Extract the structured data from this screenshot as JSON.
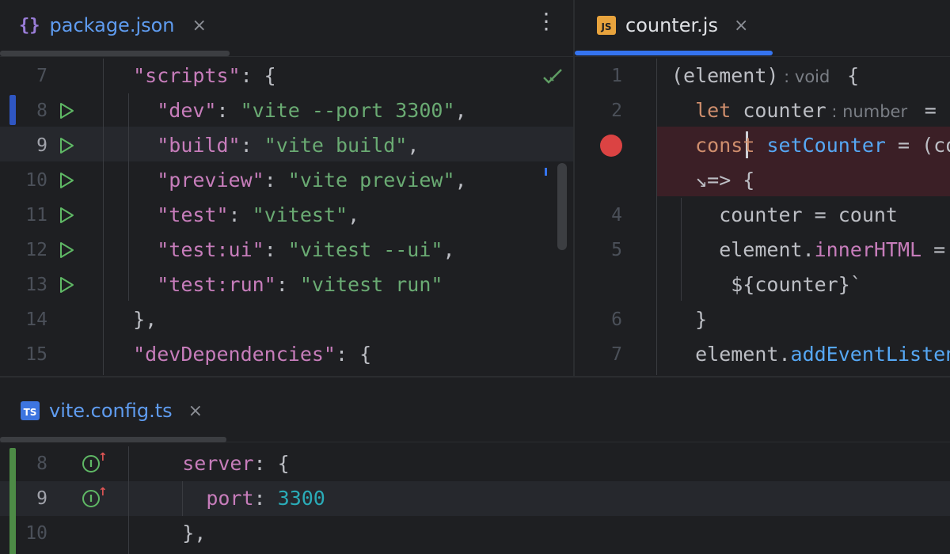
{
  "left_pane": {
    "tab": {
      "icon": "{}",
      "label": "package.json",
      "close": "×"
    },
    "menu_icon": "⋮",
    "lines": [
      {
        "num": "7",
        "tokens": [
          [
            "d",
            "  "
          ],
          [
            "p",
            "\"scripts\""
          ],
          [
            "d",
            ": {"
          ]
        ]
      },
      {
        "num": "8",
        "tokens": [
          [
            "d",
            "    "
          ],
          [
            "p",
            "\"dev\""
          ],
          [
            "d",
            ": "
          ],
          [
            "s",
            "\"vite --port 3300\""
          ],
          [
            "d",
            ","
          ]
        ]
      },
      {
        "num": "9",
        "tokens": [
          [
            "d",
            "    "
          ],
          [
            "p",
            "\"build\""
          ],
          [
            "d",
            ": "
          ],
          [
            "s",
            "\"vite build\""
          ],
          [
            "d",
            ","
          ]
        ]
      },
      {
        "num": "10",
        "tokens": [
          [
            "d",
            "    "
          ],
          [
            "p",
            "\"preview\""
          ],
          [
            "d",
            ": "
          ],
          [
            "s",
            "\"vite preview\""
          ],
          [
            "d",
            ","
          ]
        ]
      },
      {
        "num": "11",
        "tokens": [
          [
            "d",
            "    "
          ],
          [
            "p",
            "\"test\""
          ],
          [
            "d",
            ": "
          ],
          [
            "s",
            "\"vitest\""
          ],
          [
            "d",
            ","
          ]
        ]
      },
      {
        "num": "12",
        "tokens": [
          [
            "d",
            "    "
          ],
          [
            "p",
            "\"test:ui\""
          ],
          [
            "d",
            ": "
          ],
          [
            "s",
            "\"vitest --ui\""
          ],
          [
            "d",
            ","
          ]
        ]
      },
      {
        "num": "13",
        "tokens": [
          [
            "d",
            "    "
          ],
          [
            "p",
            "\"test:run\""
          ],
          [
            "d",
            ": "
          ],
          [
            "s",
            "\"vitest run\""
          ]
        ]
      },
      {
        "num": "14",
        "tokens": [
          [
            "d",
            "  },"
          ]
        ]
      },
      {
        "num": "15",
        "tokens": [
          [
            "d",
            "  "
          ],
          [
            "p",
            "\"devDependencies\""
          ],
          [
            "d",
            ": {"
          ]
        ]
      }
    ]
  },
  "right_pane": {
    "tab": {
      "icon": "JS",
      "label": "counter.js",
      "close": "×"
    },
    "lines": [
      {
        "num": "1",
        "tokens": [
          [
            "d",
            "(element)"
          ],
          [
            "hint",
            " : void "
          ],
          [
            "d",
            " {"
          ]
        ]
      },
      {
        "num": "2",
        "tokens": [
          [
            "d",
            "  "
          ],
          [
            "k",
            "let"
          ],
          [
            "d",
            " counter"
          ],
          [
            "hint",
            " : number "
          ],
          [
            "d",
            " ="
          ]
        ]
      },
      {
        "num": "",
        "tokens": [
          [
            "d",
            "  "
          ],
          [
            "k",
            "const"
          ],
          [
            "d",
            " "
          ],
          [
            "f",
            "setCounter"
          ],
          [
            "d",
            " = (co"
          ]
        ]
      },
      {
        "num": "",
        "tokens": [
          [
            "d",
            "  ↘=> {"
          ]
        ]
      },
      {
        "num": "4",
        "tokens": [
          [
            "d",
            "    counter = count"
          ]
        ]
      },
      {
        "num": "5",
        "tokens": [
          [
            "d",
            "    element."
          ],
          [
            "p",
            "innerHTML"
          ],
          [
            "d",
            " ="
          ]
        ]
      },
      {
        "num": "",
        "tokens": [
          [
            "d",
            "     ${counter}`"
          ]
        ]
      },
      {
        "num": "6",
        "tokens": [
          [
            "d",
            "  }"
          ]
        ]
      },
      {
        "num": "7",
        "tokens": [
          [
            "d",
            "  element."
          ],
          [
            "f",
            "addEventListen"
          ]
        ]
      }
    ]
  },
  "bottom_pane": {
    "tab": {
      "icon": "TS",
      "label": "vite.config.ts",
      "close": "×"
    },
    "lines": [
      {
        "num": "8",
        "tokens": [
          [
            "d",
            "    "
          ],
          [
            "p",
            "server"
          ],
          [
            "d",
            ": {"
          ]
        ]
      },
      {
        "num": "9",
        "tokens": [
          [
            "d",
            "      "
          ],
          [
            "p",
            "port"
          ],
          [
            "d",
            ": "
          ],
          [
            "n",
            "3300"
          ]
        ]
      },
      {
        "num": "10",
        "tokens": [
          [
            "d",
            "    },"
          ]
        ]
      }
    ]
  }
}
